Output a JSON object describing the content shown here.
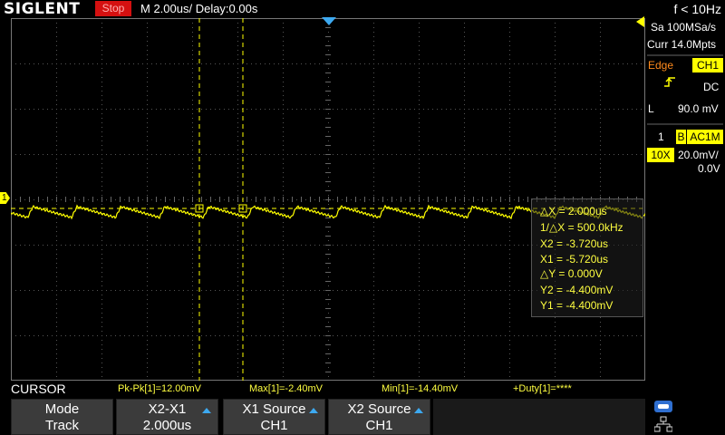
{
  "app": {
    "logo": "SIGLENT",
    "run_state": "Stop",
    "timebase": "M 2.00us/  Delay:0.00s",
    "frequency": "f < 10Hz"
  },
  "acquisition": {
    "sample_rate": "Sa 100MSa/s",
    "memory": "Curr 14.0Mpts"
  },
  "trigger": {
    "type": "Edge",
    "source": "CH1",
    "coupling": "DC",
    "level_label": "L",
    "level": "90.0 mV"
  },
  "channel1": {
    "index": "1",
    "bw_icon": "B",
    "coupling": "AC1M",
    "probe": "10X",
    "scale": "20.0mV/",
    "offset": "0.0V",
    "marker": "1",
    "color": "#ffff00"
  },
  "cursor_readout": {
    "dx": "△X = 2.000us",
    "inv_dx": "1/△X = 500.0kHz",
    "x2": "X2 = -3.720us",
    "x1": "X1 = -5.720us",
    "dy": "△Y = 0.000V",
    "y2": "Y2 = -4.400mV",
    "y1": "Y1 = -4.400mV"
  },
  "measurements": {
    "title": "CURSOR",
    "pkpk": "Pk-Pk[1]=12.00mV",
    "max": "Max[1]=-2.40mV",
    "min": "Min[1]=-14.40mV",
    "duty": "+Duty[1]=****"
  },
  "softkeys": [
    {
      "label": "Mode",
      "value": "Track"
    },
    {
      "label": "X2-X1",
      "value": "2.000us"
    },
    {
      "label": "X1 Source",
      "value": "CH1"
    },
    {
      "label": "X2 Source",
      "value": "CH1"
    }
  ],
  "icons": {
    "trigger_position": "trigger-position-marker",
    "trigger_level": "trigger-level-marker",
    "trigger_edge": "rising-edge-icon",
    "usb": "usb-icon",
    "network": "network-icon"
  },
  "colors": {
    "trace": "#ffff00",
    "accent": "#3da9f0",
    "stop": "#d51010",
    "label": "#ff8a1c"
  }
}
